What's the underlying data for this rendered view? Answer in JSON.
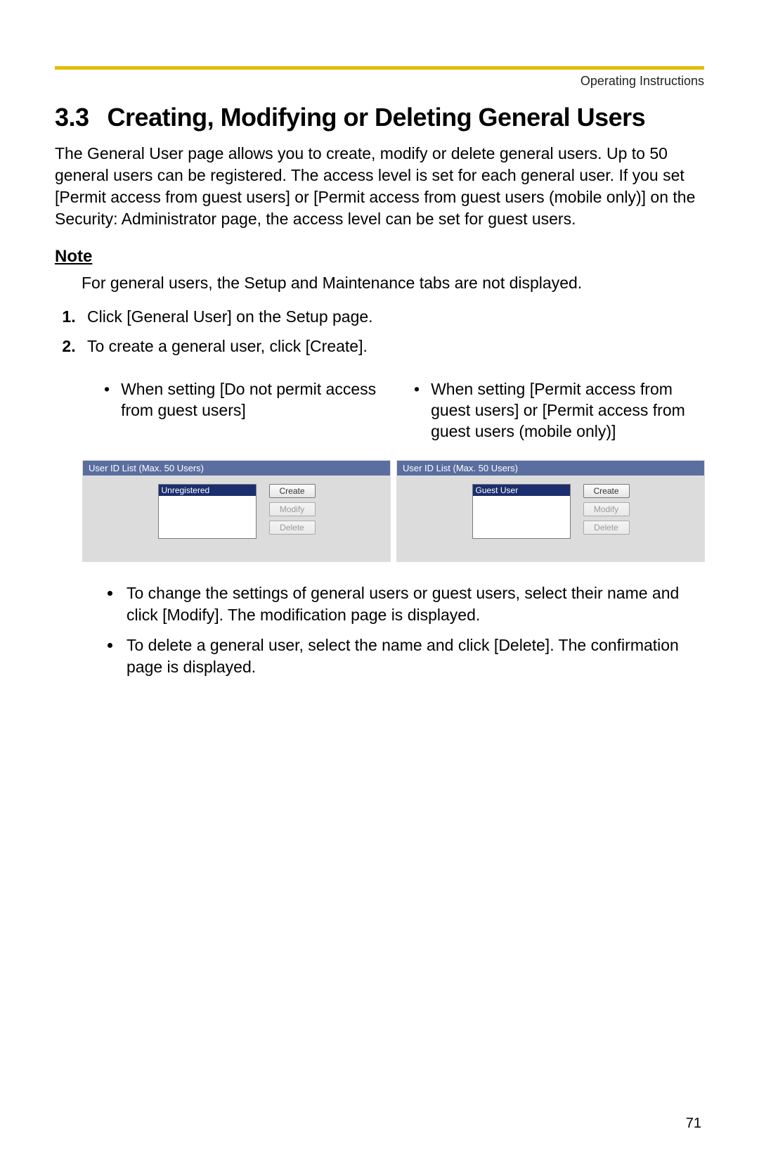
{
  "header": {
    "label": "Operating Instructions"
  },
  "section": {
    "number": "3.3",
    "title": "Creating, Modifying or Deleting General Users"
  },
  "intro": "The General User page allows you to create, modify or delete general users. Up to 50 general users can be registered. The access level is set for each general user. If you set [Permit access from guest users] or [Permit access from guest users (mobile only)] on the Security: Administrator page, the access level can be set for guest users.",
  "note": {
    "label": "Note",
    "text": "For general users, the Setup and Maintenance tabs are not displayed."
  },
  "steps": [
    "Click [General User] on the Setup page.",
    "To create a general user, click [Create]."
  ],
  "columns": {
    "left": "When setting [Do not permit access from guest users]",
    "right": "When setting [Permit access from guest users] or [Permit access from guest users (mobile only)]"
  },
  "panel": {
    "header": "User ID List (Max. 50 Users)",
    "left_item": "Unregistered",
    "right_item": "Guest User",
    "buttons": {
      "create": "Create",
      "modify": "Modify",
      "delete": "Delete"
    }
  },
  "bullets": [
    "To change the settings of general users or guest users, select their name and click [Modify]. The modification page is displayed.",
    "To delete a general user, select the name and click [Delete]. The confirmation page is displayed."
  ],
  "page_number": "71"
}
